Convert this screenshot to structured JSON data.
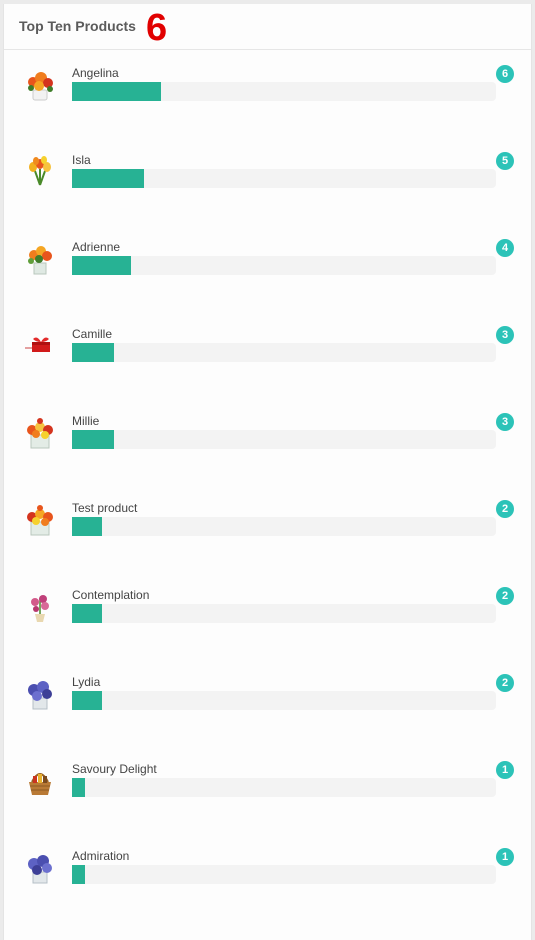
{
  "panel": {
    "title": "Top Ten Products",
    "badge": "6"
  },
  "max_count": 6,
  "products": [
    {
      "name": "Angelina",
      "count": 6,
      "bar_fraction": 0.21,
      "image": "flower-bouquet-orange-icon"
    },
    {
      "name": "Isla",
      "count": 5,
      "bar_fraction": 0.17,
      "image": "tulip-bouquet-icon"
    },
    {
      "name": "Adrienne",
      "count": 4,
      "bar_fraction": 0.14,
      "image": "flower-vase-orange-icon"
    },
    {
      "name": "Camille",
      "count": 3,
      "bar_fraction": 0.1,
      "image": "gift-box-icon"
    },
    {
      "name": "Millie",
      "count": 3,
      "bar_fraction": 0.1,
      "image": "flower-cube-icon"
    },
    {
      "name": "Test product",
      "count": 2,
      "bar_fraction": 0.07,
      "image": "flower-cube-icon"
    },
    {
      "name": "Contemplation",
      "count": 2,
      "bar_fraction": 0.07,
      "image": "orchid-pot-icon"
    },
    {
      "name": "Lydia",
      "count": 2,
      "bar_fraction": 0.07,
      "image": "hydrangea-vase-icon"
    },
    {
      "name": "Savoury Delight",
      "count": 1,
      "bar_fraction": 0.03,
      "image": "gift-basket-icon"
    },
    {
      "name": "Admiration",
      "count": 1,
      "bar_fraction": 0.03,
      "image": "hydrangea-vase-icon"
    }
  ],
  "colors": {
    "bar_fill": "#27b294",
    "bar_track": "#f3f3f3",
    "count_badge": "#2cc3b8",
    "title_badge": "#e10000"
  }
}
